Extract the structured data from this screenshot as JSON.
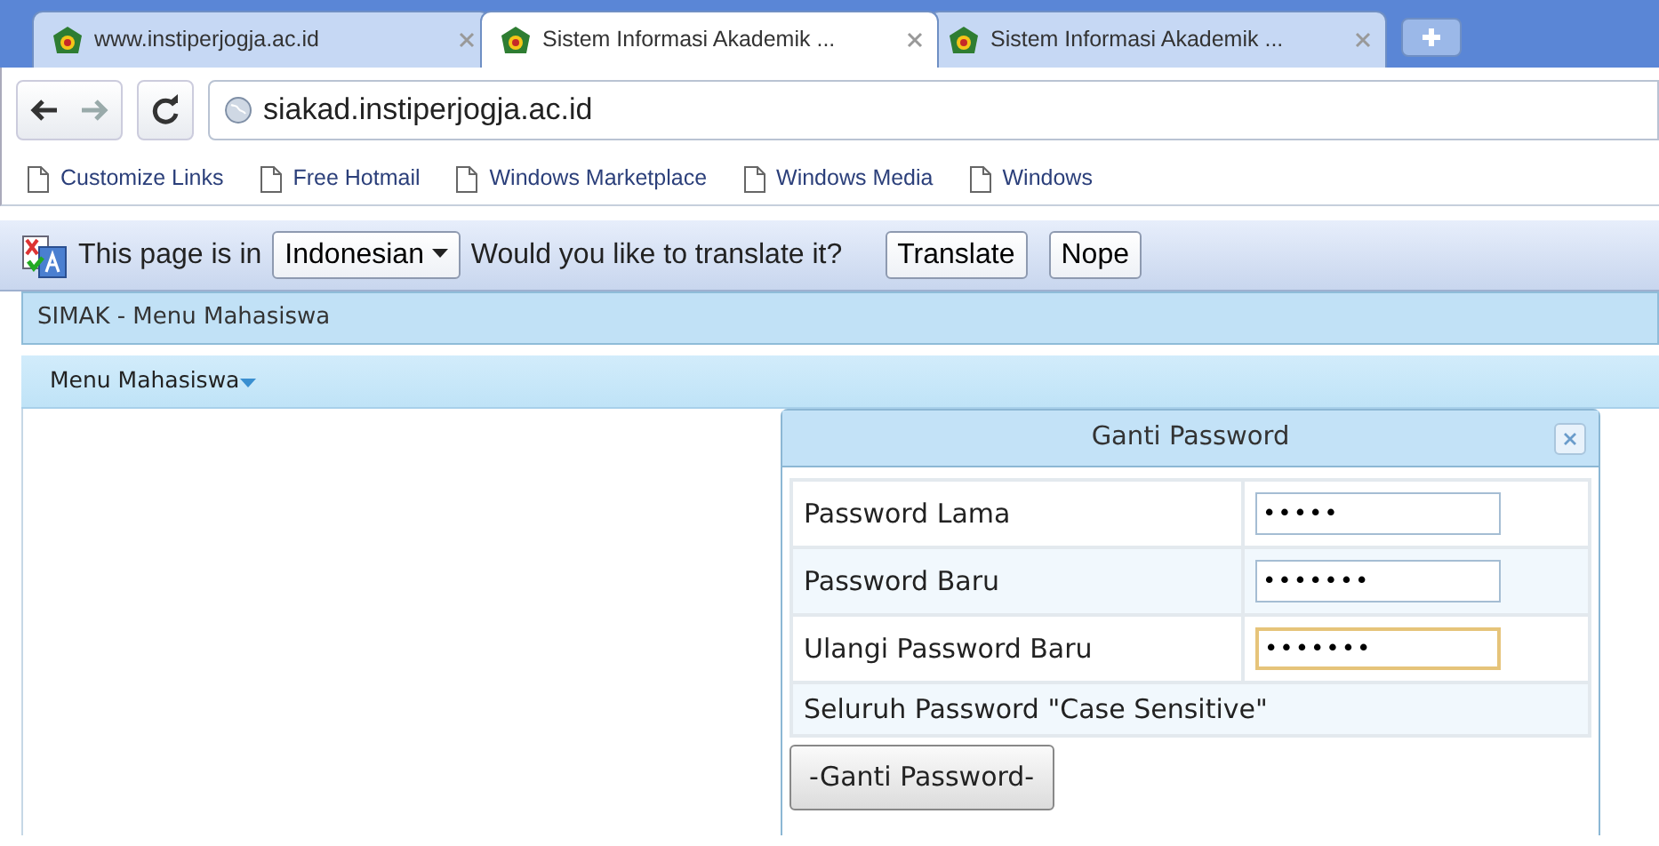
{
  "tabs": [
    {
      "title": "www.instiperjogja.ac.id",
      "selected": false
    },
    {
      "title": "Sistem Informasi Akademik ...",
      "selected": true
    },
    {
      "title": "Sistem Informasi Akademik ...",
      "selected": false
    }
  ],
  "address_bar": {
    "url": "siakad.instiperjogja.ac.id"
  },
  "bookmarks": [
    "Customize Links",
    "Free Hotmail",
    "Windows Marketplace",
    "Windows Media",
    "Windows"
  ],
  "translate_bar": {
    "prefix": "This page is in",
    "language": "Indonesian",
    "question": "Would you like to translate it?",
    "buttons": [
      "Translate",
      "Nope"
    ]
  },
  "page": {
    "title": "SIMAK - Menu Mahasiswa",
    "menu": "Menu Mahasiswa"
  },
  "dialog": {
    "title": "Ganti Password",
    "fields": [
      {
        "label": "Password Lama",
        "value": "•••••",
        "focused": false
      },
      {
        "label": "Password Baru",
        "value": "•••••••",
        "focused": false
      },
      {
        "label": "Ulangi Password Baru",
        "value": "•••••••",
        "focused": true
      }
    ],
    "note": "Seluruh Password \"Case Sensitive\"",
    "button": "-Ganti Password-"
  }
}
